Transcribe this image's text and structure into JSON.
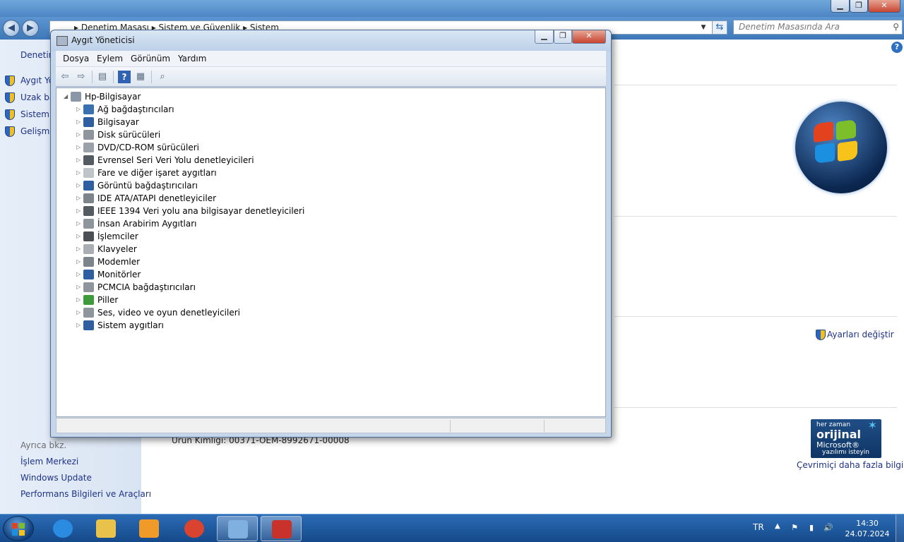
{
  "control_panel": {
    "address_path": "▸ Denetim Masası ▸ Sistem ve Güvenlik ▸ Sistem",
    "search_placeholder": "Denetim Masasında Ara",
    "sidebar_title": "Denetim",
    "sidebar_links": [
      "Aygıt Yö",
      "Uzak ba",
      "Sistem k",
      "Gelişmiş"
    ],
    "see_also_label": "Ayrıca bkz.",
    "see_also_links": [
      "İşlem Merkezi",
      "Windows Update",
      "Performans Bilgileri ve Araçları"
    ],
    "settings_link": "Ayarları değiştir",
    "product_id": "Ürün Kimliği: 00371-OEM-8992671-00008",
    "genuine_badge": {
      "line1": "her zaman",
      "line2": "orijinal",
      "line3": "Microsoft®",
      "line4": "yazılımı isteyin"
    },
    "more_info_link": "Çevrimiçi daha fazla bilgi..."
  },
  "device_manager": {
    "title": "Aygıt Yöneticisi",
    "menu": [
      "Dosya",
      "Eylem",
      "Görünüm",
      "Yardım"
    ],
    "root": "Hp-Bilgisayar",
    "categories": [
      {
        "label": "Ağ bağdaştırıcıları",
        "icon": "network-adapter-icon",
        "color": "#3a6fb0"
      },
      {
        "label": "Bilgisayar",
        "icon": "computer-icon",
        "color": "#2f5fa0"
      },
      {
        "label": "Disk sürücüleri",
        "icon": "disk-drive-icon",
        "color": "#8e959c"
      },
      {
        "label": "DVD/CD-ROM sürücüleri",
        "icon": "dvd-drive-icon",
        "color": "#9aa1a8"
      },
      {
        "label": "Evrensel Seri Veri Yolu denetleyicileri",
        "icon": "usb-controller-icon",
        "color": "#555b62"
      },
      {
        "label": "Fare ve diğer işaret aygıtları",
        "icon": "mouse-icon",
        "color": "#bfc4c9"
      },
      {
        "label": "Görüntü bağdaştırıcıları",
        "icon": "display-adapter-icon",
        "color": "#2f5fa0"
      },
      {
        "label": "IDE ATA/ATAPI denetleyiciler",
        "icon": "ide-controller-icon",
        "color": "#7d848b"
      },
      {
        "label": "IEEE 1394 Veri yolu ana bilgisayar denetleyicileri",
        "icon": "ieee1394-icon",
        "color": "#555b62"
      },
      {
        "label": "İnsan Arabirim Aygıtları",
        "icon": "hid-icon",
        "color": "#8e959c"
      },
      {
        "label": "İşlemciler",
        "icon": "processor-icon",
        "color": "#4a4f55"
      },
      {
        "label": "Klavyeler",
        "icon": "keyboard-icon",
        "color": "#a9aeb4"
      },
      {
        "label": "Modemler",
        "icon": "modem-icon",
        "color": "#7d848b"
      },
      {
        "label": "Monitörler",
        "icon": "monitor-icon",
        "color": "#2f5fa0"
      },
      {
        "label": "PCMCIA bağdaştırıcıları",
        "icon": "pcmcia-icon",
        "color": "#8e959c"
      },
      {
        "label": "Piller",
        "icon": "battery-icon",
        "color": "#3e9a3a"
      },
      {
        "label": "Ses, video ve oyun denetleyicileri",
        "icon": "speaker-icon",
        "color": "#8e959c"
      },
      {
        "label": "Sistem aygıtları",
        "icon": "system-devices-icon",
        "color": "#2f5fa0"
      }
    ]
  },
  "taskbar": {
    "apps": [
      {
        "name": "internet-explorer",
        "icon": "internet-explorer-icon",
        "color": "#2a8be0"
      },
      {
        "name": "windows-explorer",
        "icon": "folder-icon",
        "color": "#e8c24a"
      },
      {
        "name": "media-player",
        "icon": "media-player-icon",
        "color": "#f09a2a"
      },
      {
        "name": "chrome",
        "icon": "chrome-icon",
        "color": "#d9432f"
      },
      {
        "name": "control-panel",
        "icon": "control-panel-icon",
        "color": "#7fb0df",
        "active": true
      },
      {
        "name": "toolbox",
        "icon": "toolbox-icon",
        "color": "#c8322a",
        "active": true
      }
    ],
    "language": "TR",
    "time": "14:30",
    "date": "24.07.2024"
  }
}
